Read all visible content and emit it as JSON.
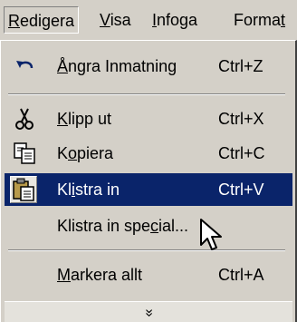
{
  "menubar": {
    "items": [
      {
        "pre": "",
        "key": "R",
        "post": "edigera"
      },
      {
        "pre": "",
        "key": "V",
        "post": "isa"
      },
      {
        "pre": "",
        "key": "I",
        "post": "nfoga"
      },
      {
        "pre": "Forma",
        "key": "t",
        "post": ""
      }
    ]
  },
  "menu": {
    "undo": {
      "pre": "",
      "key": "Å",
      "post": "ngra Inmatning",
      "shortcut": "Ctrl+Z",
      "icon": "undo-arrow-icon"
    },
    "cut": {
      "pre": "",
      "key": "K",
      "post": "lipp ut",
      "shortcut": "Ctrl+X",
      "icon": "scissors-icon"
    },
    "copy": {
      "pre": "K",
      "key": "o",
      "post": "piera",
      "shortcut": "Ctrl+C",
      "icon": "copy-icon"
    },
    "paste": {
      "pre": "Kl",
      "key": "i",
      "post": "stra in",
      "shortcut": "Ctrl+V",
      "icon": "clipboard-icon"
    },
    "paste_special": {
      "pre": "Klistra in spe",
      "key": "c",
      "post": "ial...",
      "shortcut": ""
    },
    "select_all": {
      "pre": "",
      "key": "M",
      "post": "arkera allt",
      "shortcut": "Ctrl+A"
    },
    "expand_glyph": "»"
  },
  "colors": {
    "highlight": "#0a246a",
    "menu_bg": "#d4d0c8"
  }
}
